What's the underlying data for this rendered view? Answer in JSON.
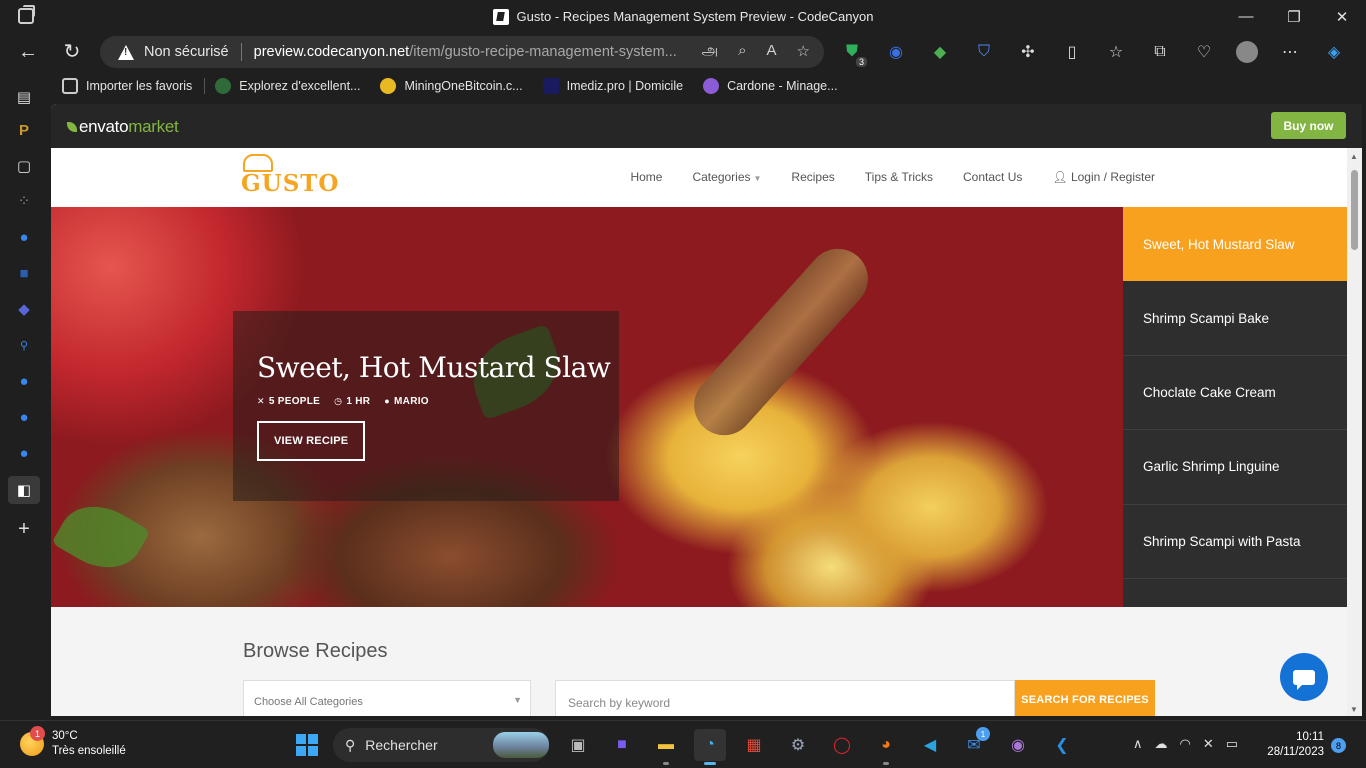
{
  "browser": {
    "window_title": "Gusto - Recipes Management System Preview - CodeCanyon",
    "security_label": "Non sécurisé",
    "url_domain": "preview.codecanyon.net",
    "url_path": "/item/gusto-recipe-management-system...",
    "reader_icon_text": "அ",
    "extension_badge": "3",
    "favorites": [
      {
        "label": "Importer les favoris",
        "color": "#c8c8c8"
      },
      {
        "label": "Explorez d'excellent...",
        "color": "#2f6b3a"
      },
      {
        "label": "MiningOneBitcoin.c...",
        "color": "#e8b923"
      },
      {
        "label": "Imediz.pro | Domicile",
        "color": "#1a1a60"
      },
      {
        "label": "Cardone - Minage...",
        "color": "#8b5cd6"
      }
    ]
  },
  "envato": {
    "logo_text": "envato",
    "logo_market": "market",
    "buy_label": "Buy now",
    "accent": "#82b541"
  },
  "site": {
    "logo": "GUSTO",
    "nav": [
      "Home",
      "Categories",
      "Recipes",
      "Tips & Tricks",
      "Contact Us",
      "Login / Register"
    ],
    "accent": "#f8a11f",
    "hero": {
      "title": "Sweet, Hot Mustard Slaw",
      "people": "5 PEOPLE",
      "time": "1 HR",
      "author": "MARIO",
      "button": "VIEW RECIPE"
    },
    "side_recipes": [
      "Sweet, Hot Mustard Slaw",
      "Shrimp Scampi Bake",
      "Choclate Cake Cream",
      "Garlic Shrimp Linguine",
      "Shrimp Scampi with Pasta"
    ],
    "browse": {
      "title": "Browse Recipes",
      "category_placeholder": "Choose All Categories",
      "keyword_placeholder": "Search by keyword",
      "search_button": "SEARCH FOR RECIPES"
    }
  },
  "taskbar": {
    "weather_temp": "30°C",
    "weather_desc": "Très ensoleillé",
    "weather_badge": "1",
    "search_label": "Rechercher",
    "mail_badge": "1",
    "time": "10:11",
    "date": "28/11/2023",
    "notifications": "8"
  }
}
